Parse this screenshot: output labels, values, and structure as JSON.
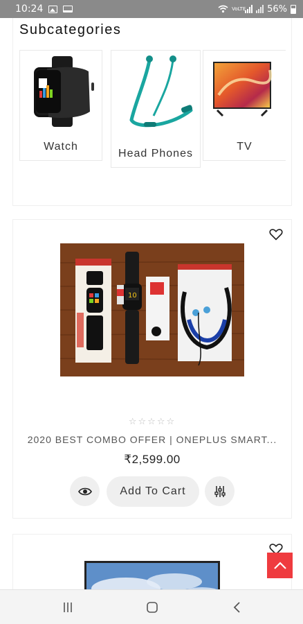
{
  "status_bar": {
    "time": "10:24",
    "network": "VoLTE",
    "battery": "56%"
  },
  "subcategories": {
    "title": "Subcategories",
    "items": [
      {
        "label": "Watch",
        "icon": "smartwatch-image"
      },
      {
        "label": "Head Phones",
        "icon": "neckband-headphones-image"
      },
      {
        "label": "TV",
        "icon": "television-image"
      }
    ]
  },
  "products": [
    {
      "name": "2020 BEST COMBO OFFER | ONEPLUS SMART...",
      "price": "₹2,599.00",
      "rating_stars": "☆☆☆☆☆",
      "rating": 0,
      "add_to_cart_label": "Add To Cart",
      "image": "watch-and-earphones-combo-image"
    },
    {
      "image": "television-image"
    }
  ],
  "icons": {
    "wishlist": "heart-icon",
    "quick_view": "eye-icon",
    "compare": "sliders-icon",
    "scroll_top": "chevron-up-icon"
  },
  "colors": {
    "accent": "#ef3b3f",
    "status_bar": "#8a8a8a",
    "button_bg": "#efefef"
  }
}
